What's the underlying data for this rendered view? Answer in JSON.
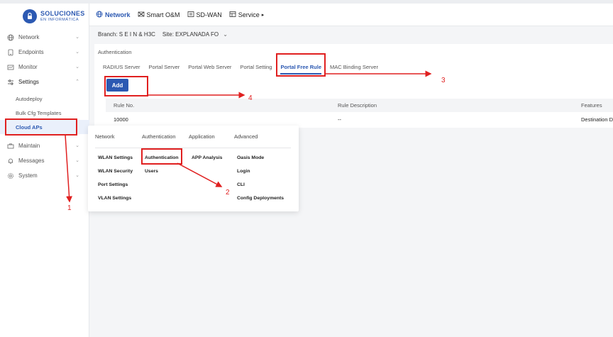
{
  "brand": {
    "line1": "SOLUCIONES",
    "line2": "EN INFORMÁTICA",
    "color": "#2c59b2"
  },
  "sidebar": {
    "items": [
      {
        "label": "Network",
        "icon": "globe-icon",
        "chevron": "⌄"
      },
      {
        "label": "Endpoints",
        "icon": "tablet-icon",
        "chevron": "⌄"
      },
      {
        "label": "Monitor",
        "icon": "monitor-icon",
        "chevron": "⌄"
      },
      {
        "label": "Settings",
        "icon": "sliders-icon",
        "chevron": "⌃"
      }
    ],
    "settings_sub": [
      "Autodeploy",
      "Bulk Cfg Templates",
      "Cloud APs"
    ],
    "items_after": [
      {
        "label": "Maintain",
        "icon": "toolbox-icon",
        "chevron": "⌄"
      },
      {
        "label": "Messages",
        "icon": "bell-icon",
        "chevron": "⌄"
      },
      {
        "label": "System",
        "icon": "gear-icon",
        "chevron": "⌄"
      }
    ]
  },
  "header": {
    "nav": [
      "Network",
      "Smart O&M",
      "SD-WAN",
      "Service"
    ],
    "service_caret": "▸"
  },
  "breadbar": {
    "branch": "Branch: S E I N & H3C",
    "site": "Site: EXPLANADA FO",
    "site_caret": "⌄"
  },
  "panel": {
    "title": "Authentication",
    "tabs": [
      "RADIUS Server",
      "Portal Server",
      "Portal Web Server",
      "Portal Setting",
      "Portal Free Rule",
      "MAC Binding Server"
    ],
    "active_tab": "Portal Free Rule",
    "add_label": "Add",
    "table": {
      "headers": [
        "Rule No.",
        "Rule Description",
        "Features"
      ],
      "rows": [
        [
          "10000",
          "--",
          "Destination D"
        ]
      ]
    }
  },
  "dropdown": {
    "headers": [
      "Network",
      "Authentication",
      "Application",
      "Advanced"
    ],
    "network": [
      "WLAN Settings",
      "WLAN Security",
      "Port Settings",
      "VLAN Settings"
    ],
    "authentication": [
      "Authentication",
      "Users"
    ],
    "application": [
      "APP Analysis"
    ],
    "advanced": [
      "Oasis Mode",
      "Login",
      "CLI",
      "Config Deployments"
    ]
  },
  "annotations": {
    "labels": [
      "1",
      "2",
      "3",
      "4"
    ],
    "color": "#e02020"
  }
}
